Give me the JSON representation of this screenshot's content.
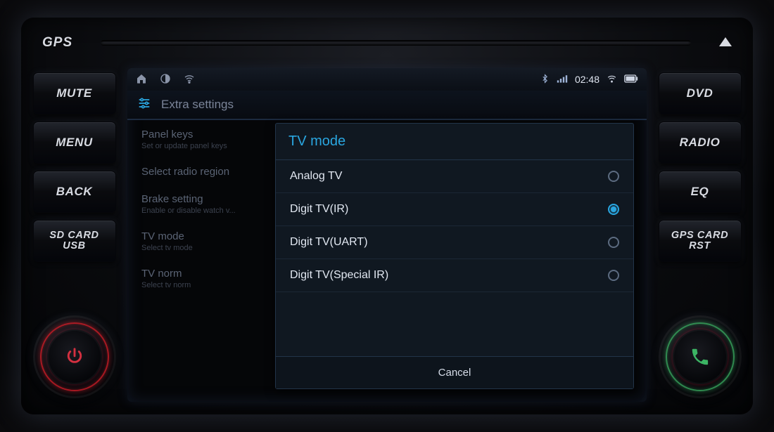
{
  "hardware": {
    "top_left_label": "GPS",
    "top_right_icon": "eject",
    "left_buttons": [
      "MUTE",
      "MENU",
      "BACK",
      "SD CARD\nUSB"
    ],
    "right_buttons": [
      "DVD",
      "RADIO",
      "EQ",
      "GPS CARD\nRST"
    ],
    "left_knob_icon": "power",
    "right_knob_icon": "phone"
  },
  "statusbar": {
    "left_icons": [
      "home",
      "contrast",
      "wifi"
    ],
    "right_icons": [
      "bluetooth",
      "signal"
    ],
    "time": "02:48",
    "right_extra": [
      "wifi",
      "battery"
    ]
  },
  "titlebar": {
    "icon": "sliders",
    "title": "Extra settings"
  },
  "settings": [
    {
      "title": "Panel keys",
      "desc": "Set or update panel keys"
    },
    {
      "title": "Select radio region",
      "desc": ""
    },
    {
      "title": "Brake setting",
      "desc": "Enable or disable watch v..."
    },
    {
      "title": "TV mode",
      "desc": "Select tv mode"
    },
    {
      "title": "TV norm",
      "desc": "Select tv norm"
    }
  ],
  "dialog": {
    "title": "TV mode",
    "options": [
      {
        "label": "Analog TV",
        "selected": false
      },
      {
        "label": "Digit TV(IR)",
        "selected": true
      },
      {
        "label": "Digit TV(UART)",
        "selected": false
      },
      {
        "label": "Digit TV(Special IR)",
        "selected": false
      }
    ],
    "cancel": "Cancel"
  }
}
